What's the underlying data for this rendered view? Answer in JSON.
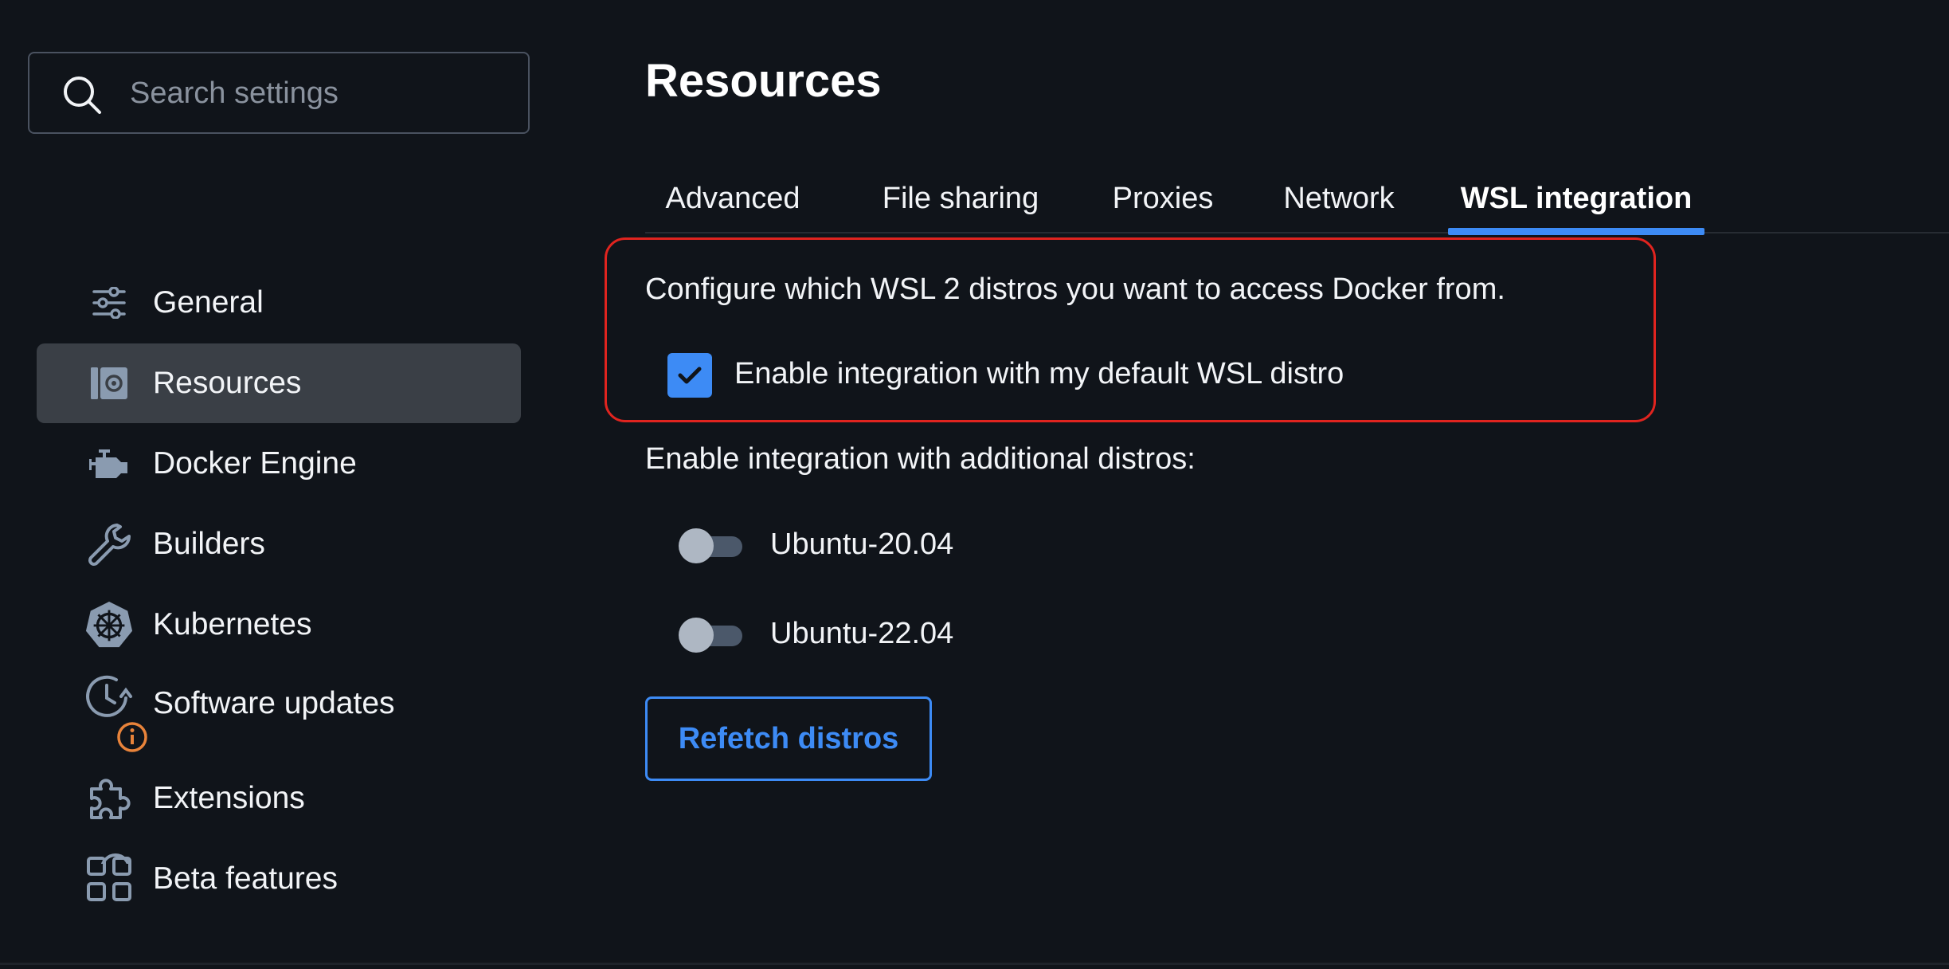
{
  "search": {
    "placeholder": "Search settings"
  },
  "sidebar": {
    "items": [
      {
        "label": "General",
        "icon": "sliders-icon"
      },
      {
        "label": "Resources",
        "icon": "resources-icon",
        "active": true
      },
      {
        "label": "Docker Engine",
        "icon": "engine-icon"
      },
      {
        "label": "Builders",
        "icon": "wrench-icon"
      },
      {
        "label": "Kubernetes",
        "icon": "kubernetes-icon"
      },
      {
        "label": "Software updates",
        "icon": "clock-update-icon",
        "badge": "info-badge-icon"
      },
      {
        "label": "Extensions",
        "icon": "puzzle-icon"
      },
      {
        "label": "Beta features",
        "icon": "grid-icon"
      }
    ]
  },
  "main": {
    "title": "Resources",
    "tabs": [
      {
        "label": "Advanced"
      },
      {
        "label": "File sharing"
      },
      {
        "label": "Proxies"
      },
      {
        "label": "Network"
      },
      {
        "label": "WSL integration",
        "active": true
      }
    ],
    "description": "Configure which WSL 2 distros you want to access Docker from.",
    "default_integration": {
      "label": "Enable integration with my default WSL distro",
      "checked": true
    },
    "additional_label": "Enable integration with additional distros:",
    "distros": [
      {
        "name": "Ubuntu-20.04",
        "enabled": false
      },
      {
        "name": "Ubuntu-22.04",
        "enabled": false
      }
    ],
    "refetch_label": "Refetch distros"
  },
  "colors": {
    "background": "#10141a",
    "accent": "#3d8bf5",
    "active_item": "#3a3f46",
    "highlight": "#e0241f",
    "icon": "#8a9bb0",
    "badge": "#e8833a"
  }
}
